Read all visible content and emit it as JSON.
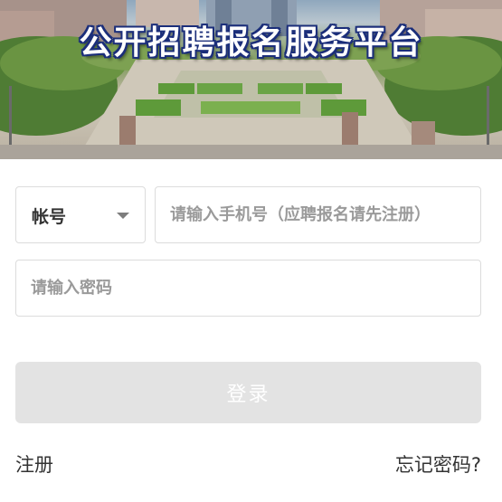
{
  "banner": {
    "title": "公开招聘报名服务平台"
  },
  "login_form": {
    "account_select": {
      "selected_value": "帐号"
    },
    "phone_input": {
      "value": "",
      "placeholder": "请输入手机号（应聘报名请先注册）"
    },
    "password_input": {
      "value": "",
      "placeholder": "请输入密码"
    },
    "login_button_label": "登录",
    "register_link": "注册",
    "forgot_password_link": "忘记密码?"
  },
  "colors": {
    "title_outline": "#1b2e7a",
    "button_disabled_bg": "#e3e3e3",
    "border": "#dcdcdc"
  }
}
